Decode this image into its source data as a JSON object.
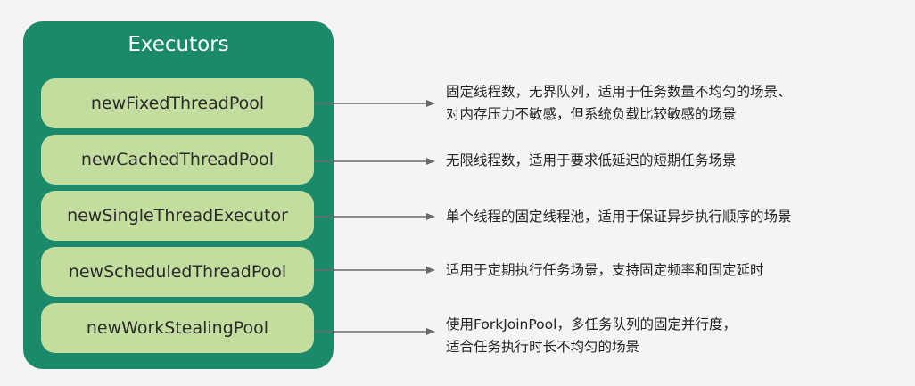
{
  "colors": {
    "panel": "#1b8a6b",
    "pill": "#c3dd9f",
    "arrow": "#6a6a6a",
    "background": "#f4f4f4"
  },
  "panel": {
    "title": "Executors"
  },
  "items": [
    {
      "name": "newFixedThreadPool",
      "description": [
        "固定线程数，无界队列，适用于任务数量不均匀的场景、",
        "对内存压力不敏感，但系统负载比较敏感的场景"
      ]
    },
    {
      "name": "newCachedThreadPool",
      "description": [
        "无限线程数，适用于要求低延迟的短期任务场景"
      ]
    },
    {
      "name": "newSingleThreadExecutor",
      "description": [
        "单个线程的固定线程池，适用于保证异步执行顺序的场景"
      ]
    },
    {
      "name": "newScheduledThreadPool",
      "description": [
        "适用于定期执行任务场景，支持固定频率和固定延时"
      ]
    },
    {
      "name": "newWorkStealingPool",
      "description": [
        "使用ForkJoinPool，多任务队列的固定并行度，",
        "适合任务执行时长不均匀的场景"
      ]
    }
  ]
}
